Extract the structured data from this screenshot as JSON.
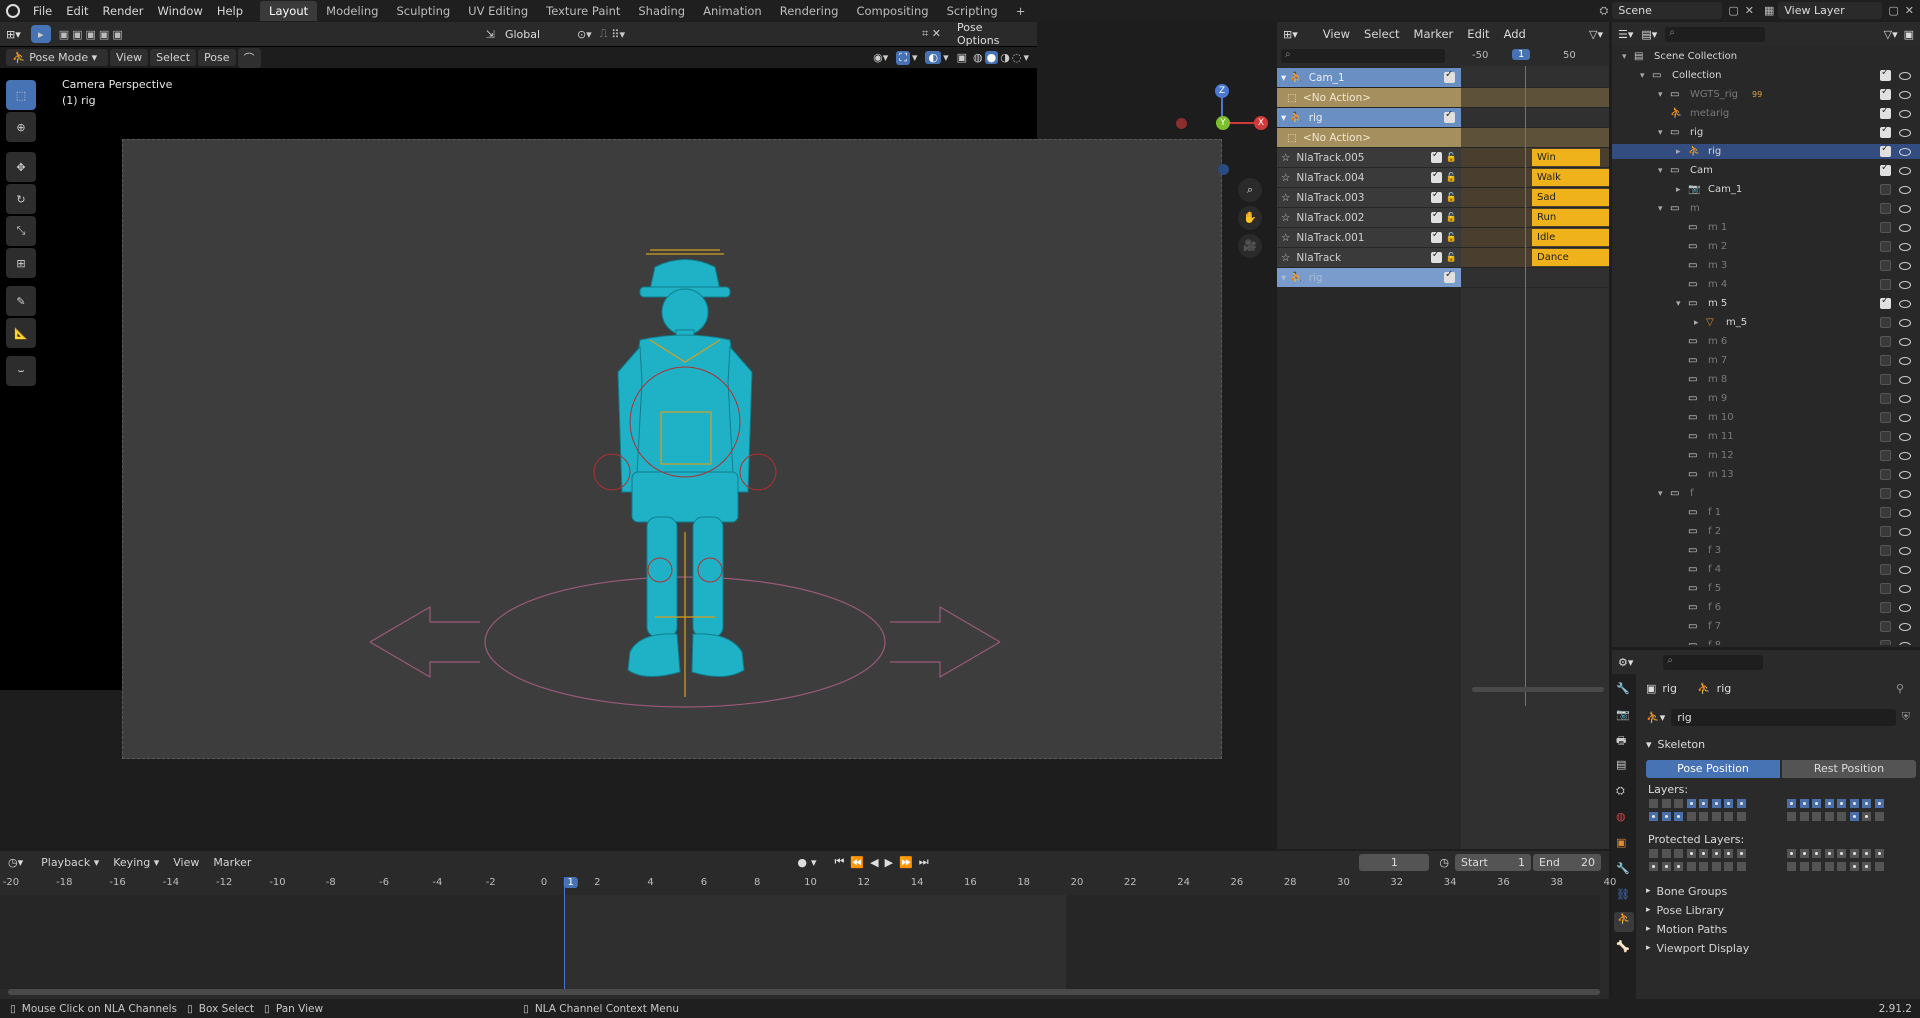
{
  "app": {
    "version": "2.91.2"
  },
  "topbar": {
    "menus": [
      "File",
      "Edit",
      "Render",
      "Window",
      "Help"
    ],
    "workspaces": [
      "Layout",
      "Modeling",
      "Sculpting",
      "UV Editing",
      "Texture Paint",
      "Shading",
      "Animation",
      "Rendering",
      "Compositing",
      "Scripting"
    ],
    "active_workspace": "Layout",
    "scene": "Scene",
    "view_layer": "View Layer"
  },
  "viewport": {
    "mode": "Pose Mode",
    "menus": [
      "View",
      "Select",
      "Pose"
    ],
    "orientation": "Global",
    "pose_options": "Pose Options",
    "overlay_title": "Camera Perspective",
    "overlay_subtitle": "(1) rig",
    "gizmo": {
      "z": "Z",
      "x": "X",
      "y": "Y"
    },
    "colors": {
      "mesh": "#1fb2c6",
      "bones": "#d4a020",
      "bg": "#3d3d3d"
    }
  },
  "nla": {
    "menus": [
      "View",
      "Select",
      "Marker",
      "Edit",
      "Add"
    ],
    "ruler": [
      "-50",
      "1",
      "50"
    ],
    "channels": [
      {
        "label": "Cam_1",
        "type": "object"
      },
      {
        "label": "<No Action>",
        "type": "action"
      },
      {
        "label": "rig",
        "type": "object"
      },
      {
        "label": "<No Action>",
        "type": "action"
      },
      {
        "label": "NlaTrack.005",
        "type": "track",
        "strip": "Win"
      },
      {
        "label": "NlaTrack.004",
        "type": "track",
        "strip": "Walk"
      },
      {
        "label": "NlaTrack.003",
        "type": "track",
        "strip": "Sad"
      },
      {
        "label": "NlaTrack.002",
        "type": "track",
        "strip": "Run"
      },
      {
        "label": "NlaTrack.001",
        "type": "track",
        "strip": "Idle"
      },
      {
        "label": "NlaTrack",
        "type": "track",
        "strip": "Dance"
      },
      {
        "label": "rig",
        "type": "object-dim"
      }
    ]
  },
  "outliner": {
    "items": [
      {
        "label": "Scene Collection",
        "depth": 0,
        "kind": "scene"
      },
      {
        "label": "Collection",
        "depth": 1,
        "kind": "coll",
        "chk": true
      },
      {
        "label": "WGTS_rig",
        "depth": 2,
        "kind": "coll",
        "dim": true,
        "chk": true,
        "extra": "99"
      },
      {
        "label": "metarig",
        "depth": 2,
        "kind": "obj",
        "dim": true,
        "chk": true
      },
      {
        "label": "rig",
        "depth": 2,
        "kind": "coll",
        "chk": true
      },
      {
        "label": "rig",
        "depth": 3,
        "kind": "armature",
        "selected": true,
        "chk": true
      },
      {
        "label": "Cam",
        "depth": 2,
        "kind": "coll",
        "chk": true
      },
      {
        "label": "Cam_1",
        "depth": 3,
        "kind": "camera",
        "chk": false
      },
      {
        "label": "m",
        "depth": 2,
        "kind": "coll",
        "dim": true,
        "chk": false
      },
      {
        "label": "m 1",
        "depth": 3,
        "kind": "coll",
        "dim": true,
        "chk": false
      },
      {
        "label": "m 2",
        "depth": 3,
        "kind": "coll",
        "dim": true,
        "chk": false
      },
      {
        "label": "m 3",
        "depth": 3,
        "kind": "coll",
        "dim": true,
        "chk": false
      },
      {
        "label": "m 4",
        "depth": 3,
        "kind": "coll",
        "dim": true,
        "chk": false
      },
      {
        "label": "m 5",
        "depth": 3,
        "kind": "coll",
        "chk": true
      },
      {
        "label": "m_5",
        "depth": 4,
        "kind": "mesh",
        "chk": false
      },
      {
        "label": "m 6",
        "depth": 3,
        "kind": "coll",
        "dim": true,
        "chk": false
      },
      {
        "label": "m 7",
        "depth": 3,
        "kind": "coll",
        "dim": true,
        "chk": false
      },
      {
        "label": "m 8",
        "depth": 3,
        "kind": "coll",
        "dim": true,
        "chk": false
      },
      {
        "label": "m 9",
        "depth": 3,
        "kind": "coll",
        "dim": true,
        "chk": false
      },
      {
        "label": "m 10",
        "depth": 3,
        "kind": "coll",
        "dim": true,
        "chk": false
      },
      {
        "label": "m 11",
        "depth": 3,
        "kind": "coll",
        "dim": true,
        "chk": false
      },
      {
        "label": "m 12",
        "depth": 3,
        "kind": "coll",
        "dim": true,
        "chk": false
      },
      {
        "label": "m 13",
        "depth": 3,
        "kind": "coll",
        "dim": true,
        "chk": false
      },
      {
        "label": "f",
        "depth": 2,
        "kind": "coll",
        "dim": true,
        "chk": false
      },
      {
        "label": "f 1",
        "depth": 3,
        "kind": "coll",
        "dim": true,
        "chk": false
      },
      {
        "label": "f 2",
        "depth": 3,
        "kind": "coll",
        "dim": true,
        "chk": false
      },
      {
        "label": "f 3",
        "depth": 3,
        "kind": "coll",
        "dim": true,
        "chk": false
      },
      {
        "label": "f 4",
        "depth": 3,
        "kind": "coll",
        "dim": true,
        "chk": false
      },
      {
        "label": "f 5",
        "depth": 3,
        "kind": "coll",
        "dim": true,
        "chk": false
      },
      {
        "label": "f 6",
        "depth": 3,
        "kind": "coll",
        "dim": true,
        "chk": false
      },
      {
        "label": "f 7",
        "depth": 3,
        "kind": "coll",
        "dim": true,
        "chk": false
      },
      {
        "label": "f 8",
        "depth": 3,
        "kind": "coll",
        "dim": true,
        "chk": false
      }
    ]
  },
  "properties": {
    "breadcrumb_obj": "rig",
    "breadcrumb_data": "rig",
    "datablock": "rig",
    "skeleton_title": "Skeleton",
    "pose_position": "Pose Position",
    "rest_position": "Rest Position",
    "layers_label": "Layers:",
    "protected_label": "Protected Layers:",
    "panels": [
      "Bone Groups",
      "Pose Library",
      "Motion Paths",
      "Viewport Display"
    ]
  },
  "timeline": {
    "menus": [
      "Playback",
      "Keying",
      "View",
      "Marker"
    ],
    "current_frame": "1",
    "start_label": "Start",
    "start": "1",
    "end_label": "End",
    "end": "20",
    "ticks": [
      "-20",
      "-18",
      "-16",
      "-14",
      "-12",
      "-10",
      "-8",
      "-6",
      "-4",
      "-2",
      "0",
      "1",
      "2",
      "4",
      "6",
      "8",
      "10",
      "12",
      "14",
      "16",
      "18",
      "20",
      "22",
      "24",
      "26",
      "28",
      "30",
      "32",
      "34",
      "36",
      "38",
      "40"
    ]
  },
  "statusbar": {
    "items": [
      "Mouse Click on NLA Channels",
      "Box Select",
      "Pan View",
      "NLA Channel Context Menu"
    ],
    "version": "2.91.2"
  }
}
